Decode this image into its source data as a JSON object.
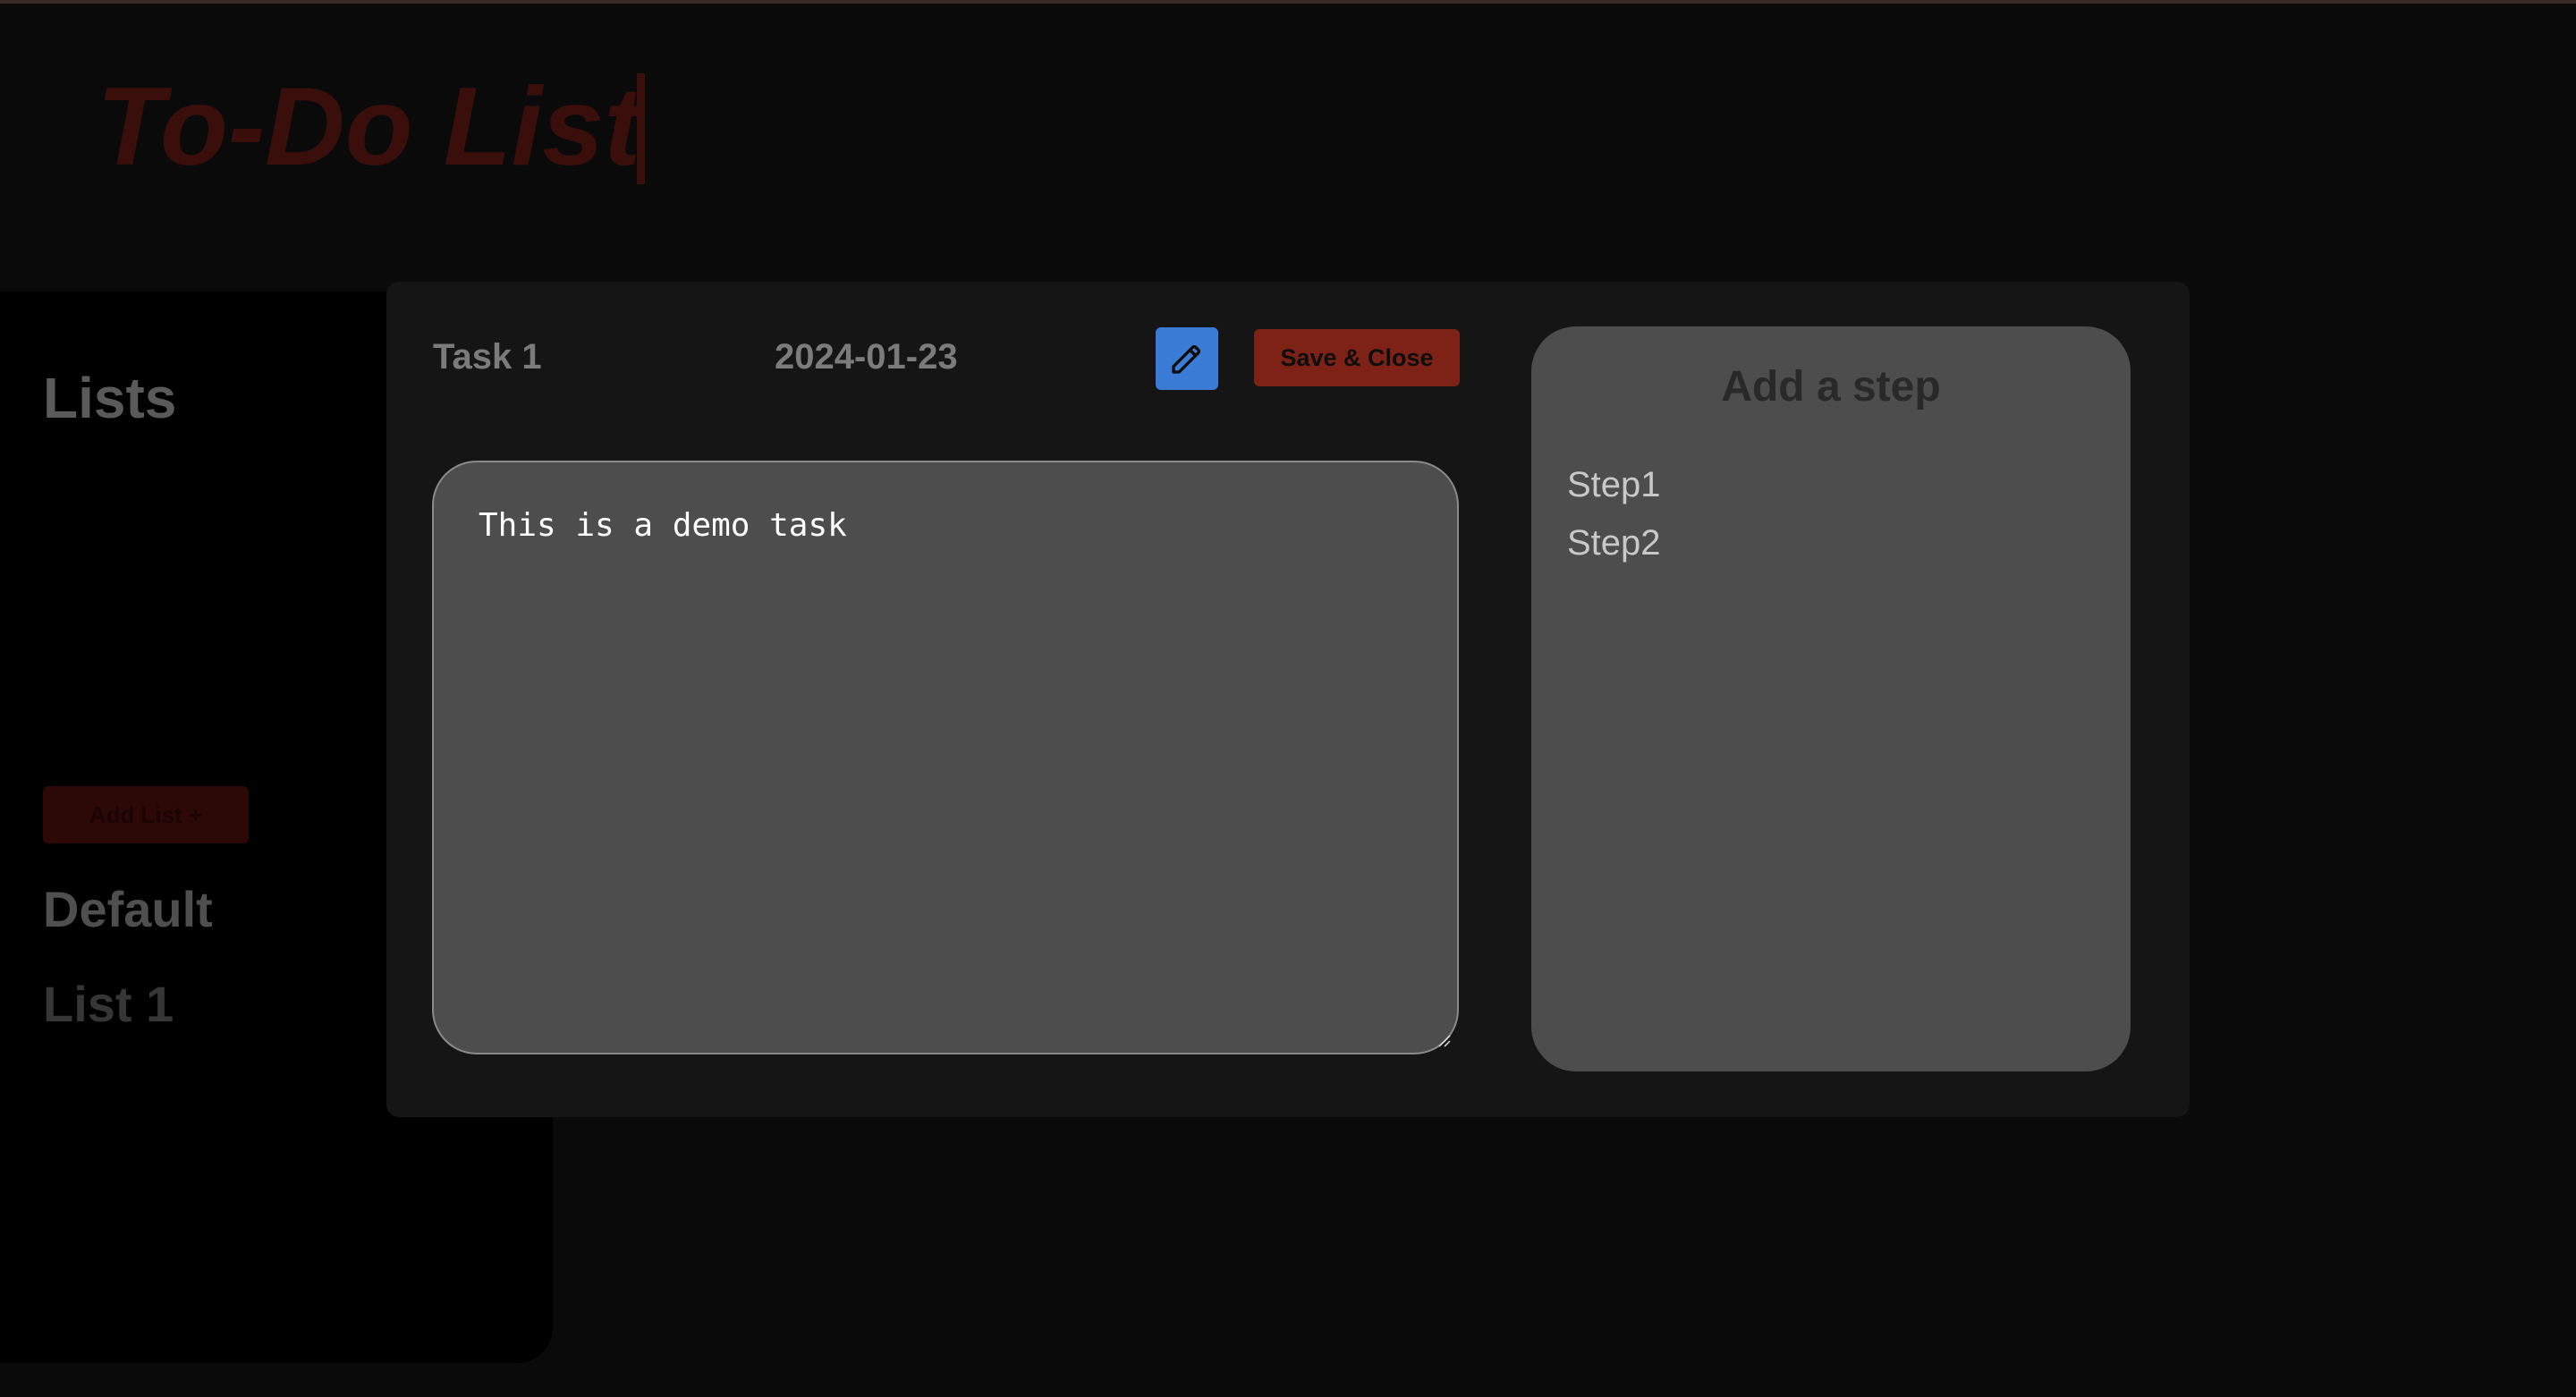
{
  "header": {
    "title": "To-Do List"
  },
  "sidebar": {
    "title": "Lists",
    "add_list_label": "Add List +",
    "lists": [
      "Default",
      "List 1"
    ]
  },
  "modal": {
    "task_name": "Task 1",
    "task_date": "2024-01-23",
    "edit_icon": "pencil-icon",
    "save_close_label": "Save & Close",
    "description": "This is a demo task",
    "steps_title": "Add a step",
    "steps": [
      "Step1",
      "Step2"
    ]
  },
  "colors": {
    "accent_blue": "#3a7bd5",
    "accent_red": "#7e2117",
    "overlay_background": "#0a0a0a",
    "modal_background": "#151515",
    "panel_gray": "#4e4d4e"
  }
}
